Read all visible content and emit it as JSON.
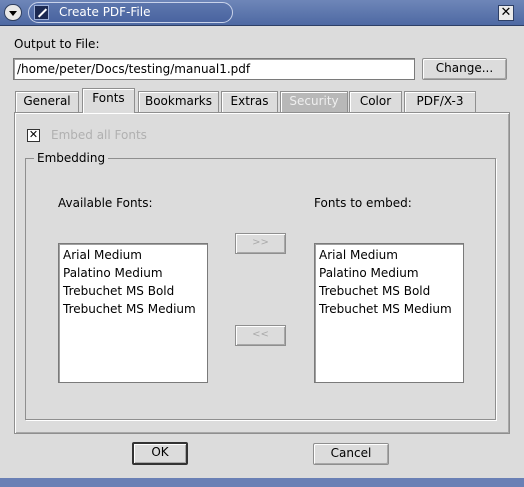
{
  "window": {
    "title": "Create PDF-File",
    "close_glyph": "✕"
  },
  "output": {
    "label": "Output to File:",
    "value": "/home/peter/Docs/testing/manual1.pdf",
    "change_label": "Change..."
  },
  "tabs": [
    {
      "label": "General",
      "state": "normal"
    },
    {
      "label": "Fonts",
      "state": "active"
    },
    {
      "label": "Bookmarks",
      "state": "normal"
    },
    {
      "label": "Extras",
      "state": "normal"
    },
    {
      "label": "Security",
      "state": "disabled"
    },
    {
      "label": "Color",
      "state": "normal"
    },
    {
      "label": "PDF/X-3",
      "state": "normal"
    }
  ],
  "fonts_tab": {
    "embed_all_label": "Embed all Fonts",
    "embed_all_checked": true,
    "check_glyph": "✕",
    "group_title": "Embedding",
    "available_label": "Available Fonts:",
    "embed_label": "Fonts to embed:",
    "available_fonts": [
      "Arial Medium",
      "Palatino Medium",
      "Trebuchet MS Bold",
      "Trebuchet MS Medium"
    ],
    "fonts_to_embed": [
      "Arial Medium",
      "Palatino Medium",
      "Trebuchet MS Bold",
      "Trebuchet MS Medium"
    ],
    "add_label": ">>",
    "remove_label": "<<"
  },
  "footer": {
    "ok_label": "OK",
    "cancel_label": "Cancel"
  },
  "colors": {
    "titlebar": "#4e69a3",
    "window_bg": "#dcdcdc",
    "disabled_text": "#b0b0b0"
  }
}
